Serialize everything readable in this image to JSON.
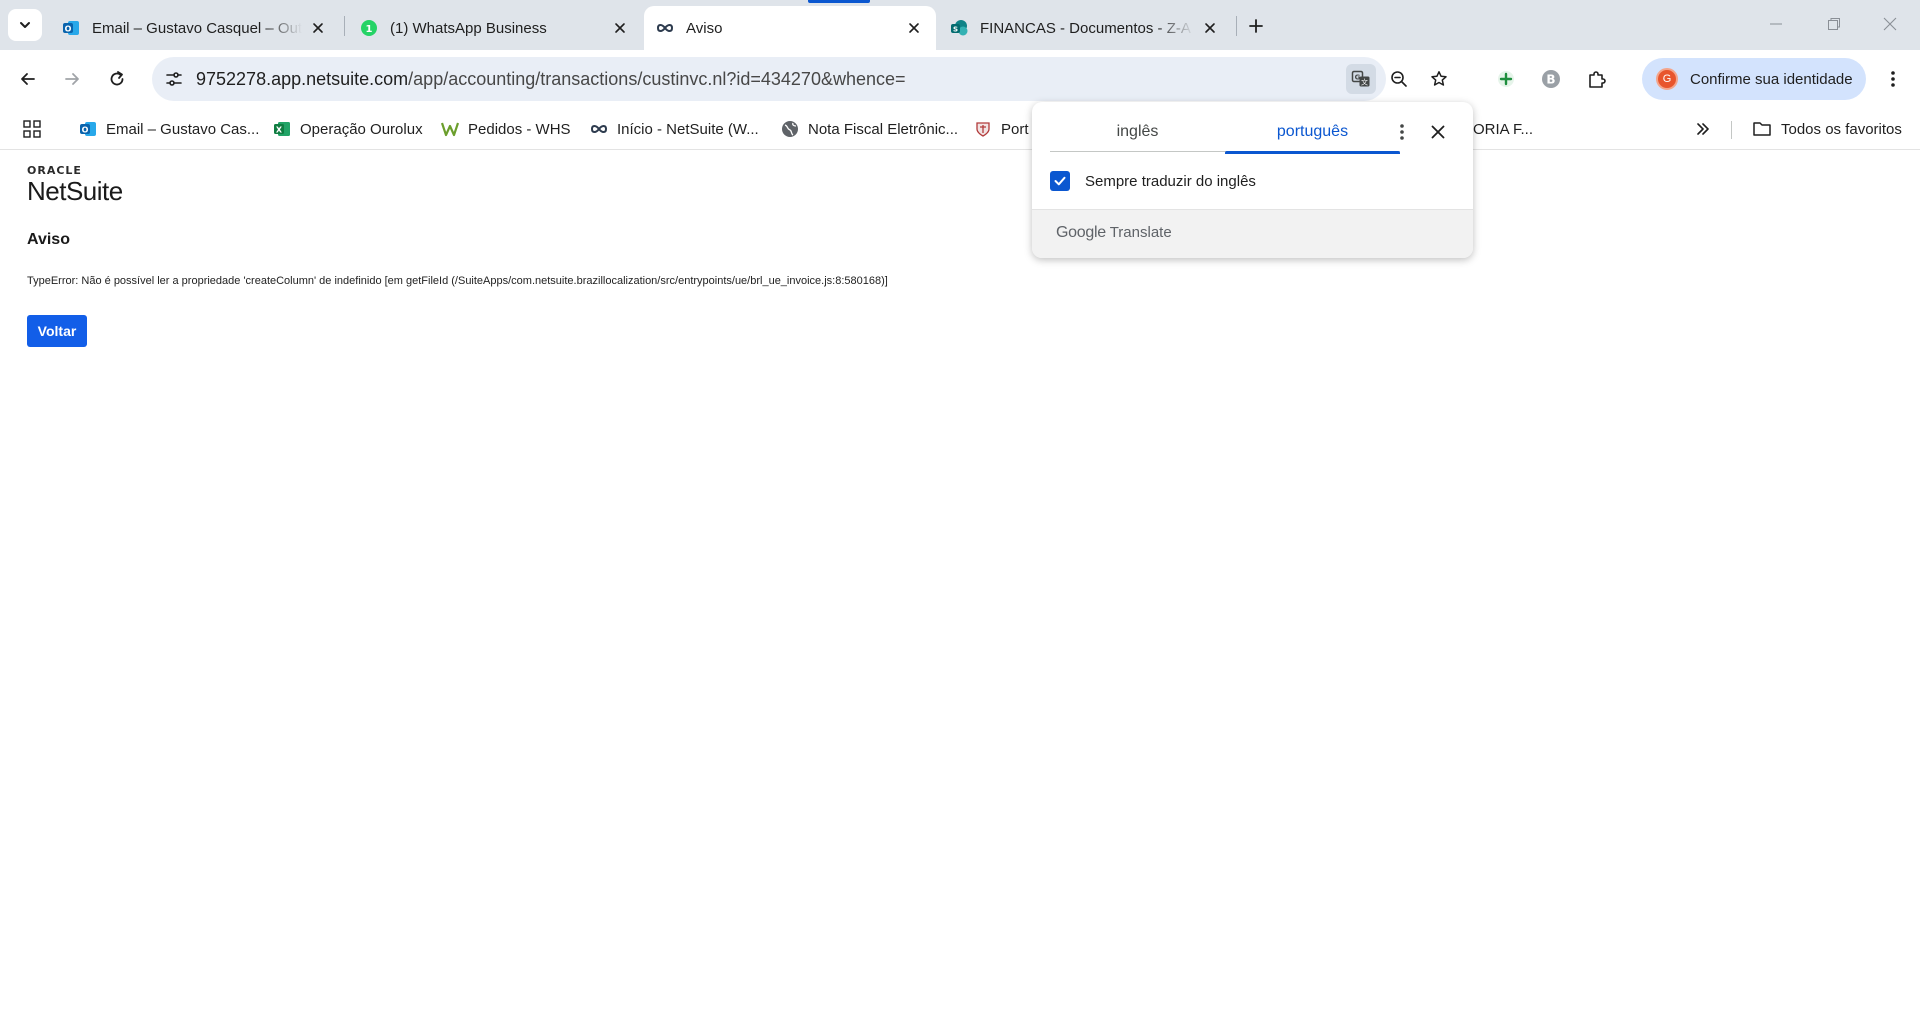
{
  "tabs": [
    {
      "title": "Email – Gustavo Casquel – Outlook",
      "icon": "outlook-icon"
    },
    {
      "title": "(1) WhatsApp Business",
      "icon": "whatsapp-icon"
    },
    {
      "title": "Aviso",
      "icon": "netsuite-icon"
    },
    {
      "title": "FINANCAS - Documentos - Z-A",
      "icon": "sharepoint-icon"
    }
  ],
  "address_bar": {
    "host": "9752278.app.netsuite.com",
    "path": "/app/accounting/transactions/custinvc.nl?id=434270&whence="
  },
  "profile": {
    "avatar_letter": "G",
    "label": "Confirme sua identidade"
  },
  "bookmarks": [
    {
      "label": "Email – Gustavo Cas...",
      "icon": "outlook-icon"
    },
    {
      "label": "Operação Ourolux",
      "icon": "excel-icon"
    },
    {
      "label": "Pedidos - WHS",
      "icon": "w-logo-icon"
    },
    {
      "label": "Início - NetSuite (W...",
      "icon": "netsuite-icon"
    },
    {
      "label": "Nota Fiscal Eletrônic...",
      "icon": "globe-icon"
    },
    {
      "label": "Port",
      "icon": "crest-icon"
    },
    {
      "label": "ORIA F...",
      "icon": ""
    }
  ],
  "bookmarks_folder": "Todos os favoritos",
  "page": {
    "logo_oracle": "ORACLE",
    "logo_netsuite": "NetSuite",
    "title": "Aviso",
    "error": "TypeError: Não é possível ler a propriedade 'createColumn' de indefinido [em getFileId (/SuiteApps/com.netsuite.brazillocalization/src/entrypoints/ue/brl_ue_invoice.js:8:580168)]",
    "back_button": "Voltar"
  },
  "translate_popup": {
    "source_language": "inglês",
    "target_language": "português",
    "always_translate_label": "Sempre traduzir do inglês",
    "always_translate_checked": true,
    "brand_google": "Google",
    "brand_translate": "Translate"
  },
  "colors": {
    "accent": "#0b57d0",
    "netsuite_button": "#125ee8",
    "tabstrip": "#dfe4ea",
    "omnibox": "#e9eef6"
  }
}
